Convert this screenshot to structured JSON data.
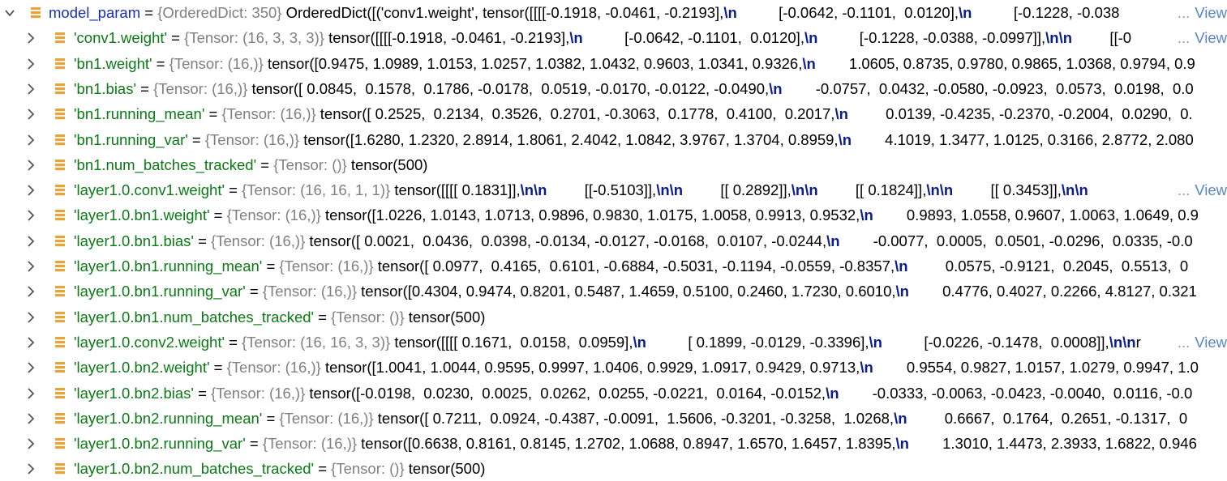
{
  "colors": {
    "root_name": "#1a2fb0",
    "key_string": "#0a7a14",
    "type_hint": "#808080",
    "escape_newline": "#0b1c8c",
    "view_link": "#5a86c6",
    "icon_orange": "#e8a33a"
  },
  "root": {
    "name": "model_param",
    "eq": " = ",
    "type": "{OrderedDict: 350}",
    "value_parts": [
      "OrderedDict([('conv1.weight', tensor([[[[-0.1918, -0.0461, -0.2193],",
      "\\n",
      "          [-0.0642, -0.1101,  0.0120],",
      "\\n",
      "          [-0.1228, -0.038"
    ],
    "has_view": true,
    "ellipsis": "...",
    "view_label": "View",
    "expanded_icon": "chevron-down-icon"
  },
  "rows": [
    {
      "name": "'conv1.weight'",
      "type": "{Tensor: (16, 3, 3, 3)}",
      "value_parts": [
        "tensor([[[[-0.1918, -0.0461, -0.2193],",
        "\\n",
        "          [-0.0642, -0.1101,  0.0120],",
        "\\n",
        "          [-0.1228, -0.0388, -0.0997]],",
        "\\n\\n",
        "         [[-0"
      ],
      "has_view": true
    },
    {
      "name": "'bn1.weight'",
      "type": "{Tensor: (16,)}",
      "value_parts": [
        "tensor([0.9475, 1.0989, 1.0153, 1.0257, 1.0382, 1.0432, 0.9603, 1.0341, 0.9326,",
        "\\n",
        "        1.0605, 0.8735, 0.9780, 0.9865, 1.0368, 0.9794, 0.9"
      ],
      "has_view": false
    },
    {
      "name": "'bn1.bias'",
      "type": "{Tensor: (16,)}",
      "value_parts": [
        "tensor([ 0.0845,  0.1578,  0.1786, -0.0178,  0.0519, -0.0170, -0.0122, -0.0490,",
        "\\n",
        "        -0.0757,  0.0432, -0.0580, -0.0923,  0.0573,  0.0198,  0.0"
      ],
      "has_view": false
    },
    {
      "name": "'bn1.running_mean'",
      "type": "{Tensor: (16,)}",
      "value_parts": [
        "tensor([ 0.2525,  0.2134,  0.3526,  0.2701, -0.3063,  0.1778,  0.4100,  0.2017,",
        "\\n",
        "         0.0139, -0.4235, -0.2370, -0.2004,  0.0290,  0."
      ],
      "has_view": false
    },
    {
      "name": "'bn1.running_var'",
      "type": "{Tensor: (16,)}",
      "value_parts": [
        "tensor([1.6280, 1.2320, 2.8914, 1.8061, 2.4042, 1.0842, 3.9767, 1.3704, 0.8959,",
        "\\n",
        "        4.1019, 1.3477, 1.0125, 0.3166, 2.8772, 2.080"
      ],
      "has_view": false
    },
    {
      "name": "'bn1.num_batches_tracked'",
      "type": "{Tensor: ()}",
      "value_parts": [
        "tensor(500)"
      ],
      "has_view": false
    },
    {
      "name": "'layer1.0.conv1.weight'",
      "type": "{Tensor: (16, 16, 1, 1)}",
      "value_parts": [
        "tensor([[[[ 0.1831]],",
        "\\n\\n",
        "         [[-0.5103]],",
        "\\n\\n",
        "         [[ 0.2892]],",
        "\\n\\n",
        "         [[ 0.1824]],",
        "\\n\\n",
        "         [[ 0.3453]],",
        "\\n\\n",
        "        "
      ],
      "has_view": true
    },
    {
      "name": "'layer1.0.bn1.weight'",
      "type": "{Tensor: (16,)}",
      "value_parts": [
        "tensor([1.0226, 1.0143, 1.0713, 0.9896, 0.9830, 1.0175, 1.0058, 0.9913, 0.9532,",
        "\\n",
        "        0.9893, 1.0558, 0.9607, 1.0063, 1.0649, 0.9"
      ],
      "has_view": false
    },
    {
      "name": "'layer1.0.bn1.bias'",
      "type": "{Tensor: (16,)}",
      "value_parts": [
        "tensor([ 0.0021,  0.0436,  0.0398, -0.0134, -0.0127, -0.0168,  0.0107, -0.0244,",
        "\\n",
        "        -0.0077,  0.0005,  0.0501, -0.0296,  0.0335, -0.0"
      ],
      "has_view": false
    },
    {
      "name": "'layer1.0.bn1.running_mean'",
      "type": "{Tensor: (16,)}",
      "value_parts": [
        "tensor([ 0.0977,  0.4165,  0.6101, -0.6884, -0.5031, -0.1194, -0.0559, -0.8357,",
        "\\n",
        "         0.0575, -0.9121,  0.2045,  0.5513,  0"
      ],
      "has_view": false
    },
    {
      "name": "'layer1.0.bn1.running_var'",
      "type": "{Tensor: (16,)}",
      "value_parts": [
        "tensor([0.4304, 0.9474, 0.8201, 0.5487, 1.4659, 0.5100, 0.2460, 1.7230, 0.6010,",
        "\\n",
        "        0.4776, 0.4027, 0.2266, 4.8127, 0.321"
      ],
      "has_view": false
    },
    {
      "name": "'layer1.0.bn1.num_batches_tracked'",
      "type": "{Tensor: ()}",
      "value_parts": [
        "tensor(500)"
      ],
      "has_view": false
    },
    {
      "name": "'layer1.0.conv2.weight'",
      "type": "{Tensor: (16, 16, 3, 3)}",
      "value_parts": [
        "tensor([[[[ 0.1671,  0.0158,  0.0959],",
        "\\n",
        "          [ 0.1899, -0.0129, -0.3396],",
        "\\n",
        "          [-0.0226, -0.1478,  0.0008]],",
        "\\n\\n",
        "r"
      ],
      "has_view": true
    },
    {
      "name": "'layer1.0.bn2.weight'",
      "type": "{Tensor: (16,)}",
      "value_parts": [
        "tensor([1.0041, 1.0044, 0.9595, 0.9997, 1.0406, 0.9929, 1.0917, 0.9429, 0.9713,",
        "\\n",
        "        0.9554, 0.9827, 1.0157, 1.0279, 0.9947, 1.0"
      ],
      "has_view": false
    },
    {
      "name": "'layer1.0.bn2.bias'",
      "type": "{Tensor: (16,)}",
      "value_parts": [
        "tensor([-0.0198,  0.0230,  0.0025,  0.0262,  0.0255, -0.0221,  0.0164, -0.0152,",
        "\\n",
        "        -0.0333, -0.0063, -0.0423, -0.0040,  0.0116, -0.0"
      ],
      "has_view": false
    },
    {
      "name": "'layer1.0.bn2.running_mean'",
      "type": "{Tensor: (16,)}",
      "value_parts": [
        "tensor([ 0.7211,  0.0924, -0.4387, -0.0091,  1.5606, -0.3201, -0.3258,  1.0268,",
        "\\n",
        "         0.6667,  0.1764,  0.2651, -0.1317,  0"
      ],
      "has_view": false
    },
    {
      "name": "'layer1.0.bn2.running_var'",
      "type": "{Tensor: (16,)}",
      "value_parts": [
        "tensor([0.6638, 0.8161, 0.8145, 1.2702, 1.0688, 0.8947, 1.6570, 1.6457, 1.8395,",
        "\\n",
        "        1.3010, 1.4473, 2.3933, 1.6822, 0.946"
      ],
      "has_view": false
    },
    {
      "name": "'layer1.0.bn2.num_batches_tracked'",
      "type": "{Tensor: ()}",
      "value_parts": [
        "tensor(500)"
      ],
      "has_view": false
    }
  ],
  "row_view": {
    "ellipsis": "...",
    "label": "View"
  },
  "row_eq": " = ",
  "collapsed_icon": "chevron-right-icon",
  "field_icon": "variable-field-icon"
}
